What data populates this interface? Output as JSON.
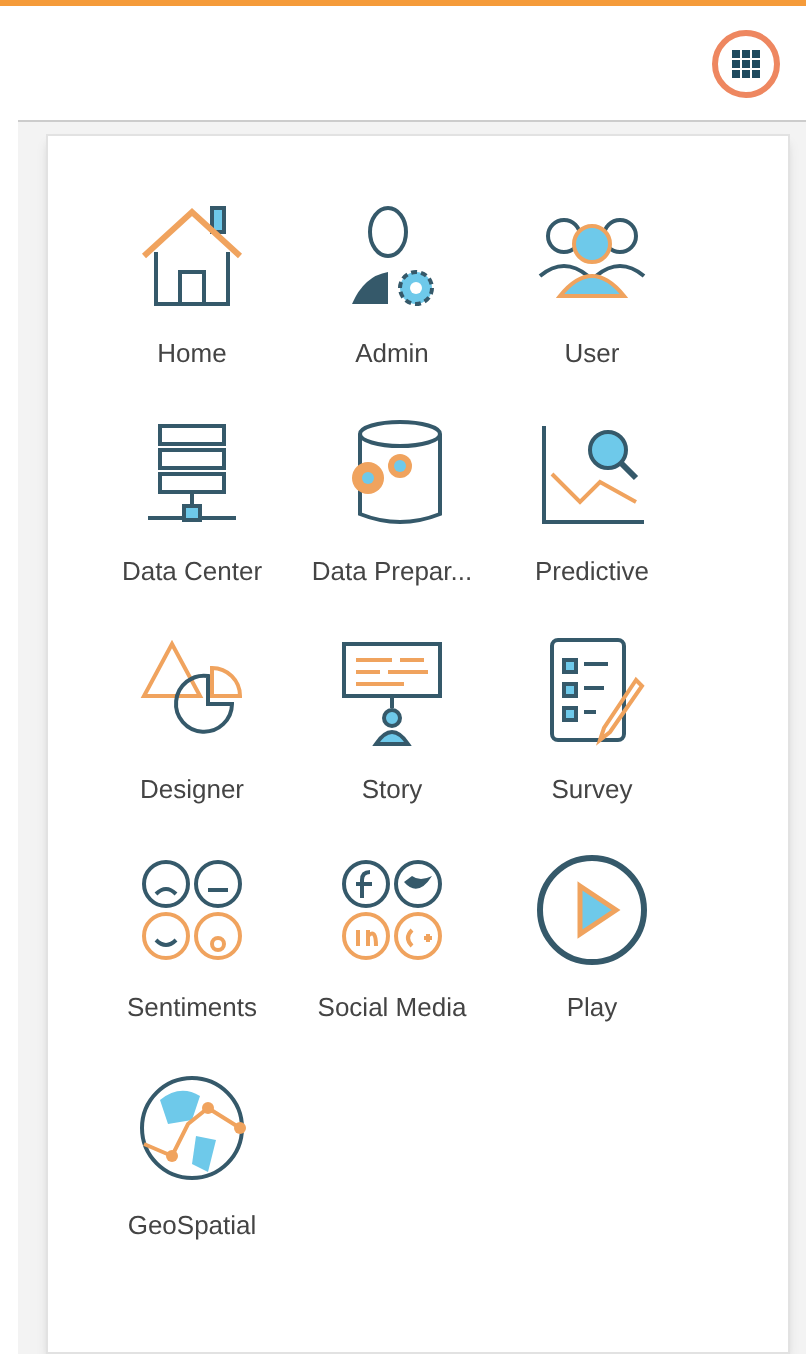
{
  "apps": [
    {
      "label": "Home"
    },
    {
      "label": "Admin"
    },
    {
      "label": "User"
    },
    {
      "label": "Data Center"
    },
    {
      "label": "Data Prepar..."
    },
    {
      "label": "Predictive"
    },
    {
      "label": "Designer"
    },
    {
      "label": "Story"
    },
    {
      "label": "Survey"
    },
    {
      "label": "Sentiments"
    },
    {
      "label": "Social Media"
    },
    {
      "label": "Play"
    },
    {
      "label": "GeoSpatial"
    }
  ]
}
